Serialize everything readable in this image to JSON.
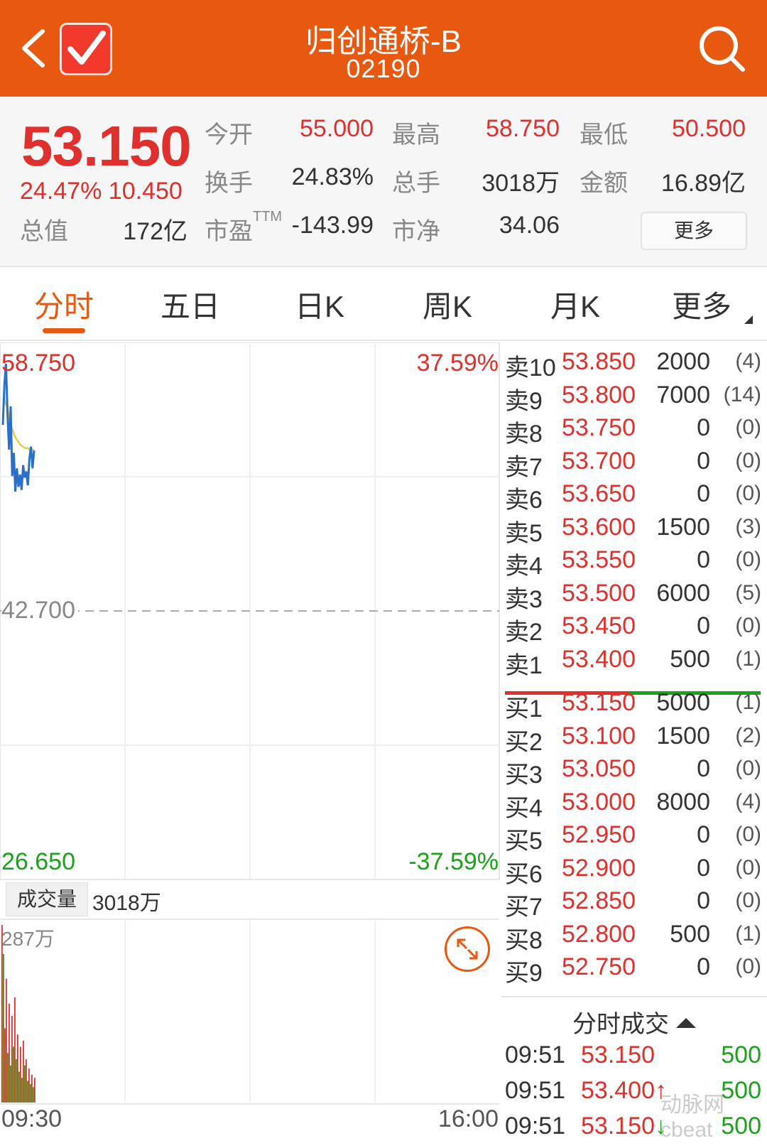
{
  "header": {
    "title": "归创通桥-B",
    "code": "02190"
  },
  "quote": {
    "price": "53.150",
    "change_pct": "24.47%",
    "change_amt": "10.450",
    "open_label": "今开",
    "open": "55.000",
    "high_label": "最高",
    "high": "58.750",
    "low_label": "最低",
    "low": "50.500",
    "turnover_label": "换手",
    "turnover": "24.83%",
    "volume_label": "总手",
    "volume": "3018万",
    "amount_label": "金额",
    "amount": "16.89亿",
    "mktcap_label": "总值",
    "mktcap": "172亿",
    "pe_label": "市盈",
    "pe_sup": "TTM",
    "pe": "-143.99",
    "pb_label": "市净",
    "pb": "34.06",
    "more_label": "更多"
  },
  "tabs": [
    "分时",
    "五日",
    "日K",
    "周K",
    "月K",
    "更多"
  ],
  "chart": {
    "y_max": "58.750",
    "y_mid": "42.700",
    "y_min": "26.650",
    "pct_max": "37.59%",
    "pct_min": "-37.59%",
    "volume_tag": "成交量",
    "volume_total": "3018万",
    "volume_max": "287万",
    "time_start": "09:30",
    "time_end": "16:00",
    "price_line": [
      54.8,
      57.4,
      58.75,
      55.5,
      53.2,
      56.0,
      51.5,
      53.0,
      50.5,
      52.0,
      50.8,
      51.6,
      50.6,
      52.2,
      51.4,
      51.8,
      50.9,
      52.6,
      53.4,
      52.0,
      53.15
    ],
    "avg_line": [
      56.5,
      56.3,
      55.9,
      55.2,
      54.6,
      54.2,
      53.9,
      53.7,
      53.5,
      53.4,
      53.3,
      53.3,
      53.2,
      53.2,
      53.2
    ],
    "volume_bars": [
      287,
      240,
      120,
      200,
      80,
      160,
      60,
      140,
      90,
      170,
      70,
      110,
      50,
      90,
      40,
      100,
      60,
      70,
      35,
      55,
      30,
      45,
      25,
      40
    ],
    "volume_colors": [
      "r",
      "g",
      "r",
      "r",
      "g",
      "r",
      "g",
      "r",
      "g",
      "r",
      "g",
      "r",
      "g",
      "r",
      "g",
      "r",
      "g",
      "r",
      "g",
      "r",
      "g",
      "r",
      "g",
      "r"
    ]
  },
  "order_book": {
    "asks": [
      {
        "label": "卖10",
        "price": "53.850",
        "qty": "2000",
        "count": "(4)"
      },
      {
        "label": "卖9",
        "price": "53.800",
        "qty": "7000",
        "count": "(14)"
      },
      {
        "label": "卖8",
        "price": "53.750",
        "qty": "0",
        "count": "(0)"
      },
      {
        "label": "卖7",
        "price": "53.700",
        "qty": "0",
        "count": "(0)"
      },
      {
        "label": "卖6",
        "price": "53.650",
        "qty": "0",
        "count": "(0)"
      },
      {
        "label": "卖5",
        "price": "53.600",
        "qty": "1500",
        "count": "(3)"
      },
      {
        "label": "卖4",
        "price": "53.550",
        "qty": "0",
        "count": "(0)"
      },
      {
        "label": "卖3",
        "price": "53.500",
        "qty": "6000",
        "count": "(5)"
      },
      {
        "label": "卖2",
        "price": "53.450",
        "qty": "0",
        "count": "(0)"
      },
      {
        "label": "卖1",
        "price": "53.400",
        "qty": "500",
        "count": "(1)"
      }
    ],
    "bids": [
      {
        "label": "买1",
        "price": "53.150",
        "qty": "5000",
        "count": "(1)"
      },
      {
        "label": "买2",
        "price": "53.100",
        "qty": "1500",
        "count": "(2)"
      },
      {
        "label": "买3",
        "price": "53.050",
        "qty": "0",
        "count": "(0)"
      },
      {
        "label": "买4",
        "price": "53.000",
        "qty": "8000",
        "count": "(4)"
      },
      {
        "label": "买5",
        "price": "52.950",
        "qty": "0",
        "count": "(0)"
      },
      {
        "label": "买6",
        "price": "52.900",
        "qty": "0",
        "count": "(0)"
      },
      {
        "label": "买7",
        "price": "52.850",
        "qty": "0",
        "count": "(0)"
      },
      {
        "label": "买8",
        "price": "52.800",
        "qty": "500",
        "count": "(1)"
      },
      {
        "label": "买9",
        "price": "52.750",
        "qty": "0",
        "count": "(0)"
      }
    ]
  },
  "trades": {
    "title": "分时成交",
    "rows": [
      {
        "time": "09:51",
        "price": "53.150",
        "dir": "",
        "vol": "500"
      },
      {
        "time": "09:51",
        "price": "53.400",
        "dir": "↑",
        "vol": "500"
      },
      {
        "time": "09:51",
        "price": "53.150",
        "dir": "↓",
        "vol": "500"
      }
    ]
  },
  "watermark": "动脉网 cbeat"
}
